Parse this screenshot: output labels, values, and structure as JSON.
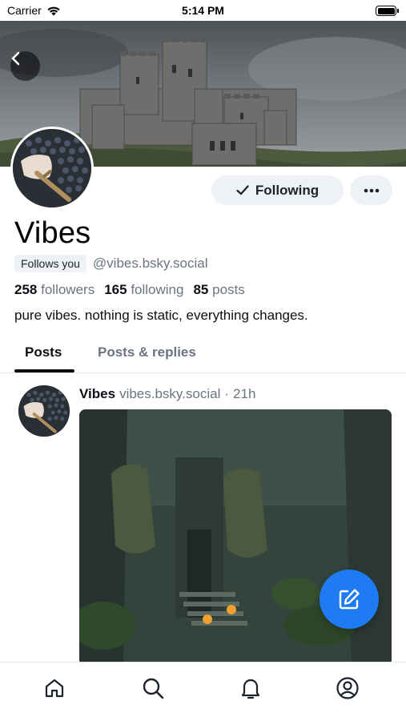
{
  "status_bar": {
    "carrier": "Carrier",
    "time": "5:14 PM"
  },
  "profile": {
    "display_name": "Vibes",
    "follows_you_badge": "Follows you",
    "handle": "@vibes.bsky.social",
    "followers_count": "258",
    "followers_label": "followers",
    "following_count": "165",
    "following_label": "following",
    "posts_count": "85",
    "posts_label": "posts",
    "bio": "pure vibes. nothing is static, everything changes.",
    "follow_button_label": "Following"
  },
  "tabs": [
    {
      "label": "Posts",
      "active": true
    },
    {
      "label": "Posts & replies",
      "active": false
    }
  ],
  "post": {
    "author": "Vibes",
    "handle": "vibes.bsky.social",
    "separator": "·",
    "time": "21h"
  },
  "icons": {
    "back": "chevron-left-icon",
    "following_check": "check-icon",
    "more": "ellipsis-icon",
    "compose": "compose-icon",
    "nav": [
      "home-icon",
      "search-icon",
      "bell-icon",
      "profile-icon"
    ]
  },
  "colors": {
    "accent": "#1e7bf2",
    "text_primary": "#0b0f14",
    "text_secondary": "#6b7480",
    "button_bg": "#eef1f5"
  }
}
